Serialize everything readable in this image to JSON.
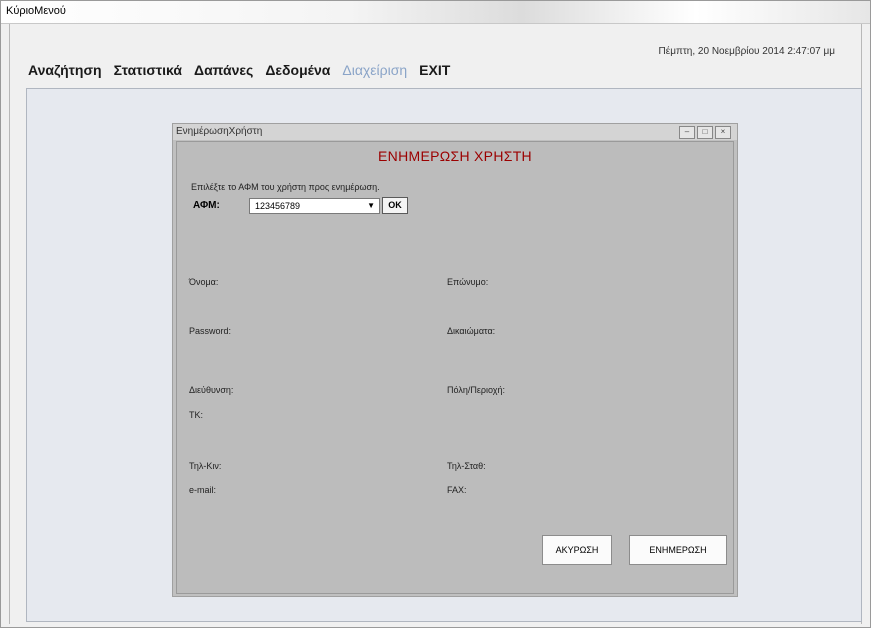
{
  "window": {
    "title": "ΚύριοΜενού"
  },
  "datetime": "Πέμπτη, 20 Νοεμβρίου 2014 2:47:07 μμ",
  "menu": {
    "items": [
      {
        "label": "Αναζήτηση"
      },
      {
        "label": "Στατιστικά"
      },
      {
        "label": "Δαπάνες"
      },
      {
        "label": "Δεδομένα"
      },
      {
        "label": "Διαχείριση"
      },
      {
        "label": "EXIT"
      }
    ]
  },
  "dialog": {
    "title": "ΕνημέρωσηΧρήστη",
    "heading": "ΕΝΗΜΕΡΩΣΗ ΧΡΗΣΤΗ",
    "hint": "Επιλέξτε το ΑΦΜ του χρήστη προς ενημέρωση.",
    "afm_label": "ΑΦΜ:",
    "afm_value": "123456789",
    "ok_label": "OK",
    "fields": {
      "name": "Όνομα:",
      "surname": "Επώνυμο:",
      "password": "Password:",
      "rights": "Δικαιώματα:",
      "address": "Διεύθυνση:",
      "city": "Πόλη/Περιοχή:",
      "postcode": "ΤΚ:",
      "mobile": "Τηλ-Κιν:",
      "landline": "Τηλ-Σταθ:",
      "email": "e-mail:",
      "fax": "FAX:"
    },
    "cancel_label": "ΑΚΥΡΩΣΗ",
    "update_label": "ΕΝΗΜΕΡΩΣΗ"
  }
}
